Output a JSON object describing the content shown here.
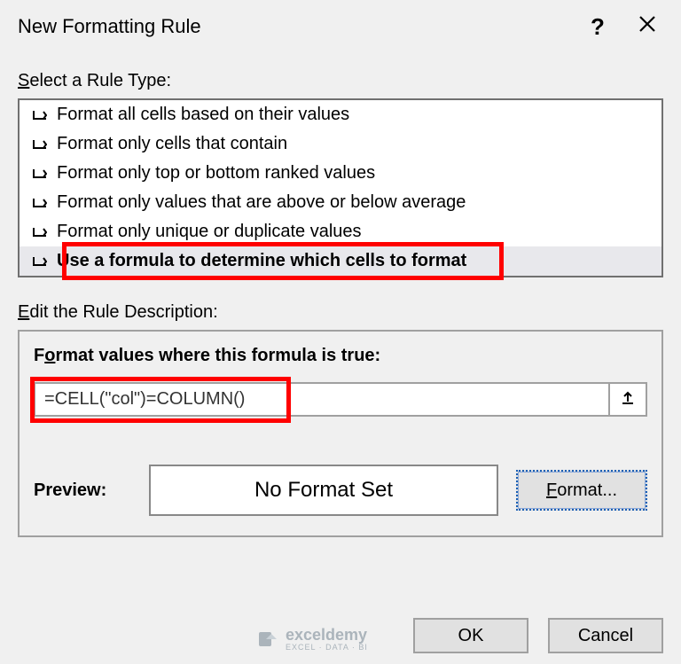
{
  "dialog": {
    "title": "New Formatting Rule"
  },
  "selectRuleType": {
    "label_prefix": "S",
    "label_rest": "elect a Rule Type:",
    "items": [
      {
        "label": "Format all cells based on their values",
        "selected": false
      },
      {
        "label": "Format only cells that contain",
        "selected": false
      },
      {
        "label": "Format only top or bottom ranked values",
        "selected": false
      },
      {
        "label": "Format only values that are above or below average",
        "selected": false
      },
      {
        "label": "Format only unique or duplicate values",
        "selected": false
      },
      {
        "label": "Use a formula to determine which cells to format",
        "selected": true,
        "highlighted": true
      }
    ]
  },
  "editRuleDescription": {
    "label_prefix": "E",
    "label_rest": "dit the Rule Description:",
    "formulaLabel_prefix": "F",
    "formulaLabel_underline": "o",
    "formulaLabel_rest": "rmat values where this formula is true:",
    "formula_value": "=CELL(\"col\")=COLUMN()",
    "preview_label": "Preview:",
    "preview_text": "No Format Set",
    "format_btn_prefix": "",
    "format_btn_underline": "F",
    "format_btn_rest": "ormat..."
  },
  "footer": {
    "ok": "OK",
    "cancel": "Cancel"
  },
  "watermark": {
    "text": "exceldemy",
    "sub": "EXCEL · DATA · BI"
  }
}
